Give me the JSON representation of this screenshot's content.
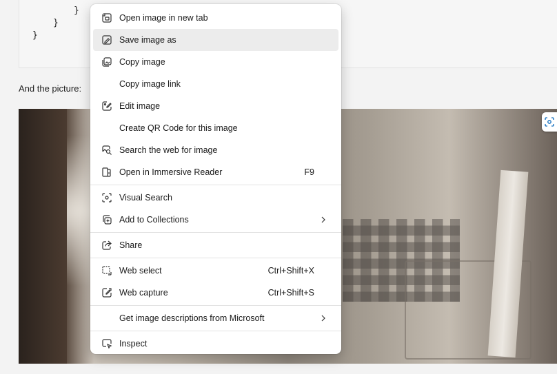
{
  "code": {
    "lines": [
      "}",
      "}",
      "}"
    ]
  },
  "prose": {
    "text": "And the picture:"
  },
  "menu": {
    "items": [
      {
        "label": "Open image in new tab",
        "icon": "open-new-tab-icon"
      },
      {
        "label": "Save image as",
        "icon": "save-image-icon",
        "hovered": true
      },
      {
        "label": "Copy image",
        "icon": "copy-image-icon"
      },
      {
        "label": "Copy image link",
        "icon": ""
      },
      {
        "label": "Edit image",
        "icon": "edit-image-icon"
      },
      {
        "label": "Create QR Code for this image",
        "icon": ""
      },
      {
        "label": "Search the web for image",
        "icon": "search-image-icon"
      },
      {
        "label": "Open in Immersive Reader",
        "icon": "immersive-reader-icon",
        "shortcut": "F9"
      },
      {
        "label": "Visual Search",
        "icon": "visual-search-icon"
      },
      {
        "label": "Add to Collections",
        "icon": "collections-icon",
        "submenu": true
      },
      {
        "label": "Share",
        "icon": "share-icon"
      },
      {
        "label": "Web select",
        "icon": "web-select-icon",
        "shortcut": "Ctrl+Shift+X"
      },
      {
        "label": "Web capture",
        "icon": "web-capture-icon",
        "shortcut": "Ctrl+Shift+S"
      },
      {
        "label": "Get image descriptions from Microsoft",
        "icon": "",
        "submenu": true
      },
      {
        "label": "Inspect",
        "icon": "inspect-icon"
      }
    ]
  },
  "colors": {
    "menu_bg": "#ffffff",
    "hover_bg": "#ececec",
    "accent": "#0f6cbd"
  }
}
